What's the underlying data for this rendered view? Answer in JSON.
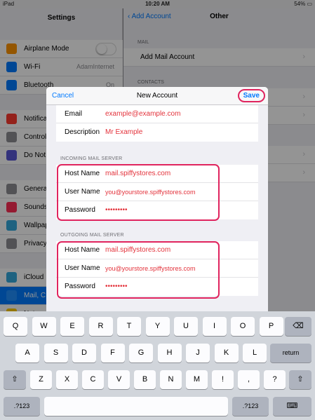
{
  "status_bar": {
    "device": "iPad",
    "time": "10:20 AM",
    "battery": "54%"
  },
  "master": {
    "title": "Settings",
    "rows": [
      {
        "label": "Airplane Mode",
        "value": "",
        "icon": "airplane-icon",
        "color": "#ff9500",
        "toggle": true
      },
      {
        "label": "Wi-Fi",
        "value": "AdamInternet",
        "icon": "wifi-icon",
        "color": "#007aff"
      },
      {
        "label": "Bluetooth",
        "value": "On",
        "icon": "bluetooth-icon",
        "color": "#007aff"
      },
      {
        "label": "Notifica",
        "value": "",
        "icon": "notifications-icon",
        "color": "#ff3b30"
      },
      {
        "label": "Control",
        "value": "",
        "icon": "control-center-icon",
        "color": "#8e8e93"
      },
      {
        "label": "Do Not",
        "value": "",
        "icon": "moon-icon",
        "color": "#5856d6"
      },
      {
        "label": "Genera",
        "value": "",
        "icon": "gear-icon",
        "color": "#8e8e93"
      },
      {
        "label": "Sounds",
        "value": "",
        "icon": "sounds-icon",
        "color": "#ff2d55"
      },
      {
        "label": "Wallpap",
        "value": "",
        "icon": "wallpaper-icon",
        "color": "#34aadc"
      },
      {
        "label": "Privacy",
        "value": "",
        "icon": "hand-icon",
        "color": "#8e8e93"
      },
      {
        "label": "iCloud",
        "value": "",
        "icon": "cloud-icon",
        "color": "#34aadc"
      },
      {
        "label": "Mail, C",
        "value": "",
        "icon": "mail-icon",
        "color": "#1f8fff",
        "selected": true
      },
      {
        "label": "Notes",
        "value": "",
        "icon": "notes-icon",
        "color": "#ffcc00"
      }
    ]
  },
  "detail": {
    "back_label": "Add Account",
    "title": "Other",
    "mail_section": "MAIL",
    "add_mail_account": "Add Mail Account",
    "contacts_section": "CONTACTS"
  },
  "modal": {
    "cancel_label": "Cancel",
    "title": "New Account",
    "save_label": "Save",
    "account_fields": [
      {
        "label": "Email",
        "value": "example@example.com"
      },
      {
        "label": "Description",
        "value": "Mr Example"
      }
    ],
    "incoming": {
      "header": "INCOMING MAIL SERVER",
      "fields": [
        {
          "label": "Host Name",
          "value": "mail.spiffystores.com"
        },
        {
          "label": "User Name",
          "value": "you@yourstore.spiffystores.com"
        },
        {
          "label": "Password",
          "value": "•••••••••"
        }
      ]
    },
    "outgoing": {
      "header": "OUTGOING MAIL SERVER",
      "fields": [
        {
          "label": "Host Name",
          "value": "mail.spiffystores.com"
        },
        {
          "label": "User Name",
          "value": "you@yourstore.spiffystores.com"
        },
        {
          "label": "Password",
          "value": "•••••••••"
        }
      ]
    },
    "highlight_color": "#e0245e",
    "value_color": "#e3323b"
  },
  "keyboard": {
    "row1": [
      "Q",
      "W",
      "E",
      "R",
      "T",
      "Y",
      "U",
      "I",
      "O",
      "P"
    ],
    "row2": [
      "A",
      "S",
      "D",
      "F",
      "G",
      "H",
      "J",
      "K",
      "L"
    ],
    "row3": [
      "Z",
      "X",
      "C",
      "V",
      "B",
      "N",
      "M",
      "!",
      ",",
      "?"
    ],
    "punct": [
      ".",
      "@",
      "?"
    ],
    "delete_icon": "backspace-icon",
    "return_label": "return",
    "shift_icon": "shift-icon",
    "numbers_label": ".?123",
    "hide_icon": "keyboard-hide-icon"
  }
}
